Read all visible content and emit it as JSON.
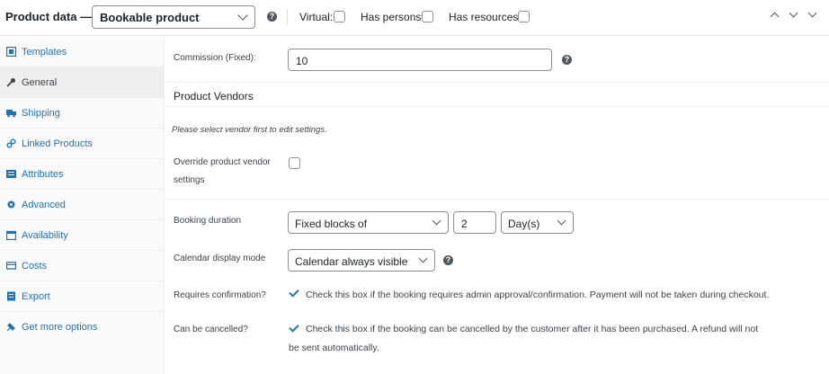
{
  "header": {
    "title": "Product data —",
    "product_type": "Bookable product",
    "virtual_label": "Virtual:",
    "has_persons_label": "Has persons:",
    "has_resources_label": "Has resources:"
  },
  "sidebar": {
    "items": [
      {
        "label": "Templates",
        "icon": "templates-icon"
      },
      {
        "label": "General",
        "icon": "wrench-icon"
      },
      {
        "label": "Shipping",
        "icon": "truck-icon"
      },
      {
        "label": "Linked Products",
        "icon": "link-icon"
      },
      {
        "label": "Attributes",
        "icon": "list-icon"
      },
      {
        "label": "Advanced",
        "icon": "gear-icon"
      },
      {
        "label": "Availability",
        "icon": "calendar-icon"
      },
      {
        "label": "Costs",
        "icon": "money-icon"
      },
      {
        "label": "Export",
        "icon": "export-icon"
      },
      {
        "label": "Get more options",
        "icon": "plugin-icon"
      }
    ],
    "active": "General"
  },
  "commission": {
    "label": "Commission (Fixed):",
    "value": "10"
  },
  "vendors": {
    "heading": "Product Vendors",
    "note": "Please select vendor first to edit settings.",
    "override_label_1": "Override product vendor",
    "override_label_2": "settings"
  },
  "booking": {
    "duration_label": "Booking duration",
    "duration_type": "Fixed blocks of",
    "duration_value": "2",
    "duration_unit": "Day(s)",
    "calendar_label": "Calendar display mode",
    "calendar_value": "Calendar always visible",
    "confirm_label": "Requires confirmation?",
    "confirm_desc": "Check this box if the booking requires admin approval/confirmation. Payment will not be taken during checkout.",
    "cancel_label": "Can be cancelled?",
    "cancel_desc_1": "Check this box if the booking can be cancelled by the customer after it has been purchased. A refund will not",
    "cancel_desc_2": "be sent automatically."
  },
  "colors": {
    "link": "#2271b1",
    "active_bg": "#eeeeee",
    "text": "#3c434a"
  }
}
